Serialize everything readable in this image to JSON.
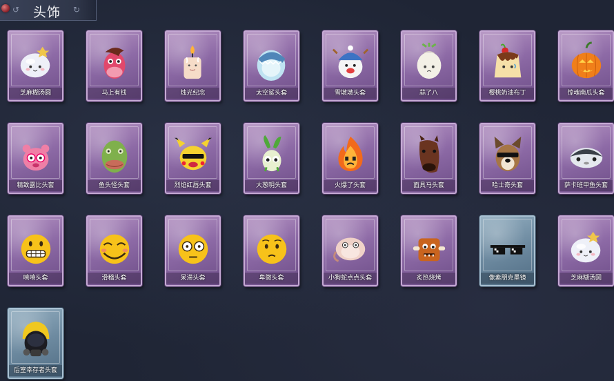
{
  "header": {
    "title": "头饰"
  },
  "items": [
    {
      "label": "芝麻糊汤圆",
      "icon": "tangyuan-icon",
      "theme": "purple"
    },
    {
      "label": "马上有钱",
      "icon": "pink-horse-icon",
      "theme": "purple"
    },
    {
      "label": "烛光纪念",
      "icon": "candle-icon",
      "theme": "purple"
    },
    {
      "label": "太空鲨头套",
      "icon": "shark-helmet-icon",
      "theme": "purple"
    },
    {
      "label": "雪墩墩头套",
      "icon": "snowman-icon",
      "theme": "purple"
    },
    {
      "label": "蒜了八",
      "icon": "garlic-icon",
      "theme": "purple"
    },
    {
      "label": "樱桃奶油布丁",
      "icon": "pudding-icon",
      "theme": "purple"
    },
    {
      "label": "惊魂南瓜头套",
      "icon": "pumpkin-icon",
      "theme": "purple"
    },
    {
      "label": "精致露比头套",
      "icon": "pink-pig-icon",
      "theme": "purple"
    },
    {
      "label": "鱼头怪头套",
      "icon": "fish-head-icon",
      "theme": "purple"
    },
    {
      "label": "烈焰红唇头套",
      "icon": "pikachu-icon",
      "theme": "purple"
    },
    {
      "label": "大葱明头套",
      "icon": "green-onion-icon",
      "theme": "purple"
    },
    {
      "label": "火爆了头套",
      "icon": "fire-icon",
      "theme": "purple"
    },
    {
      "label": "面具马头套",
      "icon": "horse-mask-icon",
      "theme": "purple"
    },
    {
      "label": "哈士奇头套",
      "icon": "husky-icon",
      "theme": "purple"
    },
    {
      "label": "萨卡班甲鱼头套",
      "icon": "fish-icon",
      "theme": "purple"
    },
    {
      "label": "嘻嘻头套",
      "icon": "grimace-emoji-icon",
      "theme": "purple"
    },
    {
      "label": "滑稽头套",
      "icon": "funny-emoji-icon",
      "theme": "purple"
    },
    {
      "label": "呆滞头套",
      "icon": "dazed-emoji-icon",
      "theme": "purple"
    },
    {
      "label": "卑微头套",
      "icon": "humble-emoji-icon",
      "theme": "purple"
    },
    {
      "label": "小狗蛇点点头套",
      "icon": "snake-dog-icon",
      "theme": "purple"
    },
    {
      "label": "炙热烧烤",
      "icon": "bbq-icon",
      "theme": "purple"
    },
    {
      "label": "像素朋克墨镜",
      "icon": "pixel-sunglasses-icon",
      "theme": "blue"
    },
    {
      "label": "芝麻糊汤圆",
      "icon": "tangyuan-icon",
      "theme": "purple"
    },
    {
      "label": "后室幸存者头套",
      "icon": "gas-mask-helmet-icon",
      "theme": "blue"
    }
  ]
}
